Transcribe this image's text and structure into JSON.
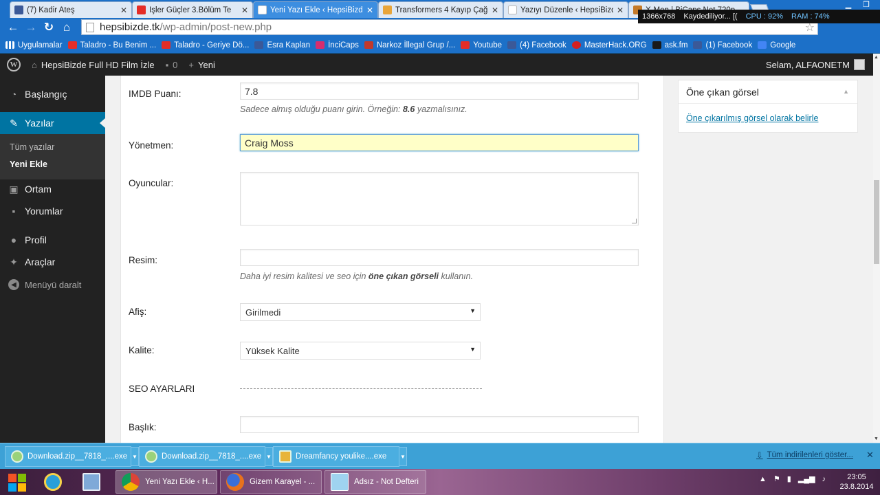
{
  "browser": {
    "tabs": [
      {
        "label": "(7) Kadir Ateş",
        "icon": "facebook-icon"
      },
      {
        "label": "İşler Güçler 3.Bölüm Te",
        "icon": "youtube-icon"
      },
      {
        "label": "Yeni Yazı Ekle ‹ HepsiBizde",
        "icon": "page-icon"
      },
      {
        "label": "Transformers 4 Kayıp Çağ",
        "icon": "transformers-icon"
      },
      {
        "label": "Yazıyı Düzenle ‹ HepsiBizd",
        "icon": "page-icon"
      },
      {
        "label": "X-Men | BiCaps Net 720p",
        "icon": "page-icon"
      }
    ],
    "url_host": "hepsibizde.tk",
    "url_path": "/wp-admin/post-new.php",
    "recorder": {
      "resolution": "1366x768",
      "status": "Kaydediliyor... [(",
      "cpu": "CPU : 92%",
      "ram": "RAM : 74%"
    }
  },
  "bookmarks": [
    {
      "label": "Uygulamalar",
      "icon": "apps-icon"
    },
    {
      "label": "Taladro - Bu Benim ...",
      "icon": "youtube-icon"
    },
    {
      "label": "Taladro - Geriye Dö...",
      "icon": "youtube-icon"
    },
    {
      "label": "Esra Kaplan",
      "icon": "facebook-icon"
    },
    {
      "label": "İnciCaps",
      "icon": "incicaps-icon"
    },
    {
      "label": "Narkoz İllegal Grup /...",
      "icon": "narkoz-icon"
    },
    {
      "label": "Youtube",
      "icon": "youtube-icon"
    },
    {
      "label": "(4) Facebook",
      "icon": "facebook-icon"
    },
    {
      "label": "MasterHack.ORG",
      "icon": "masterhack-icon"
    },
    {
      "label": "ask.fm",
      "icon": "askfm-icon"
    },
    {
      "label": "(1) Facebook",
      "icon": "facebook-icon"
    },
    {
      "label": "Google",
      "icon": "google-icon"
    }
  ],
  "adminbar": {
    "site_name": "HepsiBizde Full HD Film İzle",
    "comments_count": "0",
    "new_label": "Yeni",
    "greeting": "Selam, ALFAONETM"
  },
  "sidebar": {
    "items": [
      {
        "label": "Başlangıç",
        "icon": "dashboard-icon"
      },
      {
        "label": "Yazılar",
        "icon": "pin-icon"
      },
      {
        "label": "Ortam",
        "icon": "media-icon"
      },
      {
        "label": "Yorumlar",
        "icon": "comment-icon"
      },
      {
        "label": "Profil",
        "icon": "user-icon"
      },
      {
        "label": "Araçlar",
        "icon": "wrench-icon"
      }
    ],
    "sub_items": [
      "Tüm yazılar",
      "Yeni Ekle"
    ],
    "collapse_label": "Menüyü daralt"
  },
  "form": {
    "imdb_label": "IMDB Puanı:",
    "imdb_value": "7.8",
    "imdb_hint_pre": "Sadece almış olduğu puanı girin. Örneğin:",
    "imdb_hint_bold": "8.6",
    "imdb_hint_post": "yazmalısınız.",
    "director_label": "Yönetmen:",
    "director_value": "Craig Moss",
    "cast_label": "Oyuncular:",
    "image_label": "Resim:",
    "image_hint_pre": "Daha iyi resim kalitesi ve seo için",
    "image_hint_bold": "öne çıkan görseli",
    "image_hint_post": "kullanın.",
    "poster_label": "Afiş:",
    "poster_value": "Girilmedi",
    "quality_label": "Kalite:",
    "quality_value": "Yüksek Kalite",
    "seo_label": "SEO AYARLARI",
    "title_label": "Başlık:"
  },
  "featured_image": {
    "title": "Öne çıkan görsel",
    "link": "Öne çıkarılmış görsel olarak belirle"
  },
  "downloads": {
    "items": [
      "Download.zip__7818_....exe",
      "Download.zip__7818_....exe",
      "Dreamfancy youlike....exe"
    ],
    "show_all": "Tüm indirilenleri göster..."
  },
  "taskbar": {
    "apps": [
      {
        "label": "",
        "icon": "ie-icon"
      },
      {
        "label": "",
        "icon": "network-icon"
      },
      {
        "label": "Yeni Yazı Ekle ‹ H...",
        "icon": "chrome-icon"
      },
      {
        "label": "Gizem Karayel - ...",
        "icon": "firefox-icon"
      },
      {
        "label": "Adsız - Not Defteri",
        "icon": "notepad-icon"
      }
    ],
    "time": "23:05",
    "date": "23.8.2014"
  }
}
